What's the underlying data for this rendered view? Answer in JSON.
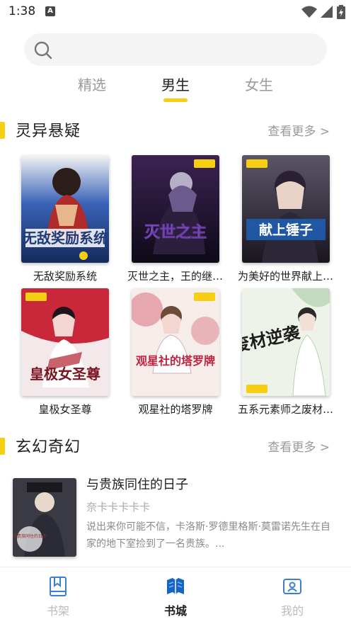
{
  "status_bar": {
    "time": "1:38",
    "notification_icon": "A"
  },
  "search": {
    "placeholder": "",
    "value": ""
  },
  "tabs": [
    {
      "label": "精选",
      "active": false
    },
    {
      "label": "男生",
      "active": true
    },
    {
      "label": "女生",
      "active": false
    }
  ],
  "sections": [
    {
      "title": "灵异悬疑",
      "more": "查看更多 >",
      "books": [
        {
          "title": "无敌奖励系统",
          "cover_text": "无敌奖励系统",
          "cover_color": "#1f3a78"
        },
        {
          "title": "灭世之主，王的继承者",
          "cover_text": "灭世之主",
          "cover_color": "#2a1a3e"
        },
        {
          "title": "为美好的世界献上锤子",
          "cover_text": "献上锤子",
          "cover_color": "#3a2f45"
        },
        {
          "title": "皇极女圣尊",
          "cover_text": "皇极女圣尊",
          "cover_color": "#c8283a"
        },
        {
          "title": "观星社的塔罗牌",
          "cover_text": "观星社的塔罗牌",
          "cover_color": "#e9c7c9"
        },
        {
          "title": "五系元素师之废材逆袭",
          "cover_text": "废材逆袭",
          "cover_color": "#e8efe4"
        }
      ]
    },
    {
      "title": "玄幻奇幻",
      "more": "查看更多 >",
      "list": [
        {
          "title": "与贵族同住的日子",
          "author": "奈卡卡卡卡卡",
          "description": "说出来你可能不信，卡洛斯·罗德里格斯·莫雷诺先生在自家的地下室捡到了一名贵族。...",
          "cover_text": "与贵族同住的日子"
        }
      ]
    }
  ],
  "bottom_nav": [
    {
      "label": "书架",
      "icon": "bookshelf-icon",
      "active": false
    },
    {
      "label": "书城",
      "icon": "bookstore-icon",
      "active": true
    },
    {
      "label": "我的",
      "icon": "profile-icon",
      "active": false
    }
  ],
  "colors": {
    "accent": "#f6cf12",
    "muted": "#9a9a9a",
    "text": "#1d1d1d",
    "nav_active": "#1d1d1d",
    "nav_inactive": "#bbbbbb"
  }
}
